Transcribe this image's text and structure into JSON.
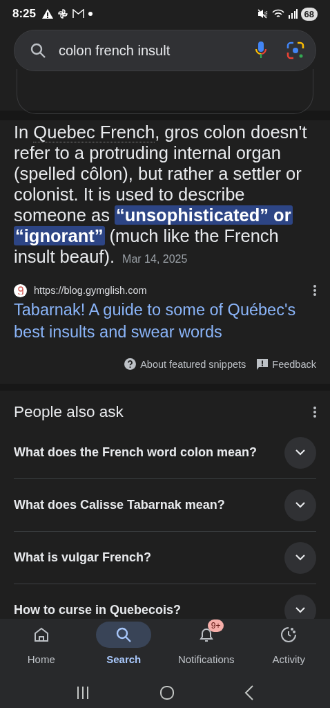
{
  "status_bar": {
    "time": "8:25",
    "battery": "68"
  },
  "search": {
    "value": "colon french insult"
  },
  "snippet": {
    "segments": [
      {
        "kind": "text",
        "text": "In "
      },
      {
        "kind": "term",
        "text": "Quebec French"
      },
      {
        "kind": "text",
        "text": ", gros colon doesn't refer to a protruding internal organ (spelled côlon), but rather a settler or colonist. It is used to describe someone as **“unsophisticated” or “ignorant”** (much like the French insult beauf)."
      }
    ],
    "date": "Mar 14, 2025",
    "source_url": "https://blog.gymglish.com",
    "title": "Tabarnak! A guide to some of Québec's best insults and swear words",
    "footer": [
      "About featured snippets",
      "Feedback"
    ]
  },
  "people_also_ask": {
    "title": "People also ask",
    "questions": [
      {
        "text": "What does the French word colon mean?",
        "expanded": false
      },
      {
        "text": "What does Calisse Tabarnak mean?",
        "expanded": false
      },
      {
        "text": "What is vulgar French?",
        "expanded": false
      },
      {
        "text": "How to curse in Quebecois?",
        "expanded": false
      }
    ]
  },
  "bottom_nav": [
    {
      "label": "Home",
      "selected": false
    },
    {
      "label": "Search",
      "selected": true
    },
    {
      "label": "Notifications",
      "selected": false,
      "badge": "9+"
    },
    {
      "label": "Activity",
      "selected": false
    }
  ]
}
